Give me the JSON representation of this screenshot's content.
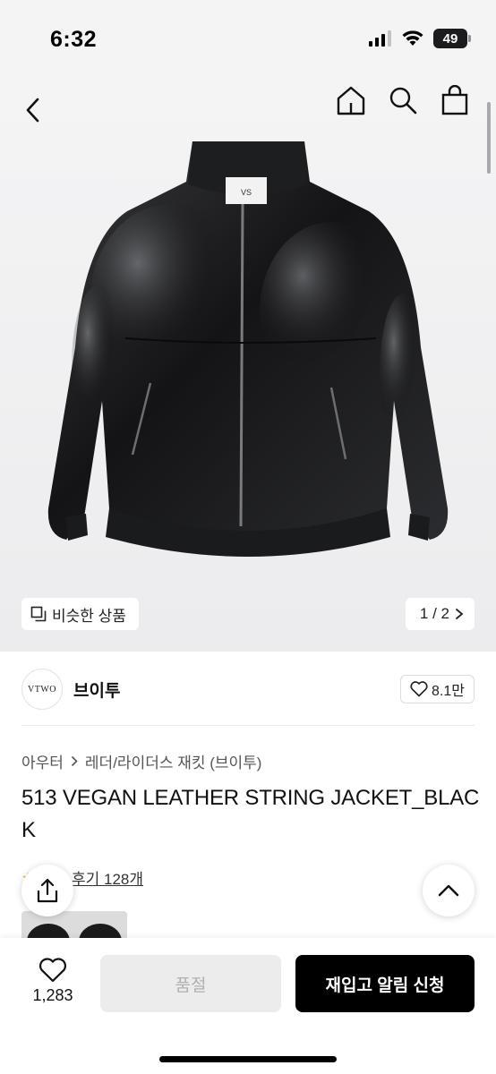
{
  "status_bar": {
    "time": "6:32",
    "battery": "49"
  },
  "header": {
    "back_icon": "chevron-left-icon",
    "icons": [
      "home-icon",
      "search-icon",
      "shopping-bag-icon"
    ]
  },
  "gallery": {
    "similar_label": "비슷한 상품",
    "pager": "1 / 2"
  },
  "brand": {
    "logo_text": "VTWO",
    "name": "브이투",
    "likes": "8.1만"
  },
  "breadcrumb": {
    "category": "아우터",
    "subcategory": "레더/라이더스 재킷 (브이투)"
  },
  "product": {
    "title": "513 VEGAN LEATHER STRING JACKET_BLACK"
  },
  "reviews": {
    "label": "후기 128개"
  },
  "bottom_bar": {
    "wish_count": "1,283",
    "soldout_label": "품절",
    "restock_label": "재입고 알림 신청"
  }
}
